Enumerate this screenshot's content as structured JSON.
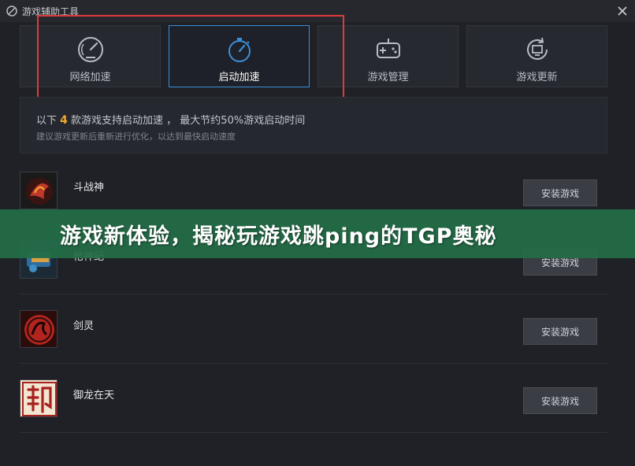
{
  "window": {
    "title": "游戏辅助工具",
    "close_icon": "close-icon"
  },
  "tabs": [
    {
      "label": "网络加速",
      "icon": "speedometer-icon",
      "active": false
    },
    {
      "label": "启动加速",
      "icon": "stopwatch-icon",
      "active": true
    },
    {
      "label": "游戏管理",
      "icon": "gamepad-icon",
      "active": false
    },
    {
      "label": "游戏更新",
      "icon": "update-icon",
      "active": false
    }
  ],
  "info": {
    "prefix": "以下",
    "count": "4",
    "suffix": "款游戏支持启动加速 ， 最大节约50%游戏启动时间",
    "hint": "建议游戏更新后重新进行优化，以达到最快启动速度"
  },
  "games": [
    {
      "name": "斗战神",
      "button": "安装游戏",
      "thumb_color": "#c0392b"
    },
    {
      "name": "枪神纪",
      "button": "安装游戏",
      "thumb_color": "#2f6d9e"
    },
    {
      "name": "剑灵",
      "button": "安装游戏",
      "thumb_color": "#b3241e"
    },
    {
      "name": "御龙在天",
      "button": "安装游戏",
      "thumb_color": "#a82020"
    }
  ],
  "banner": {
    "text": "游戏新体验，揭秘玩游戏跳ping的TGP奥秘"
  },
  "colors": {
    "accent": "#3a8fd9",
    "highlight": "#e03a3a",
    "count": "#f0a830",
    "banner_bg": "#246e48"
  }
}
